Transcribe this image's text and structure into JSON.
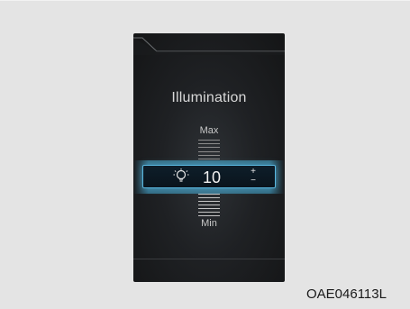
{
  "display": {
    "title": "Illumination",
    "max_label": "Max",
    "min_label": "Min",
    "value": "10",
    "increase_symbol": "+",
    "decrease_symbol": "−",
    "level_of_max": 10,
    "accent_color": "#5ab7df",
    "icon": "light-bulb-icon"
  },
  "caption": "OAE046113L"
}
